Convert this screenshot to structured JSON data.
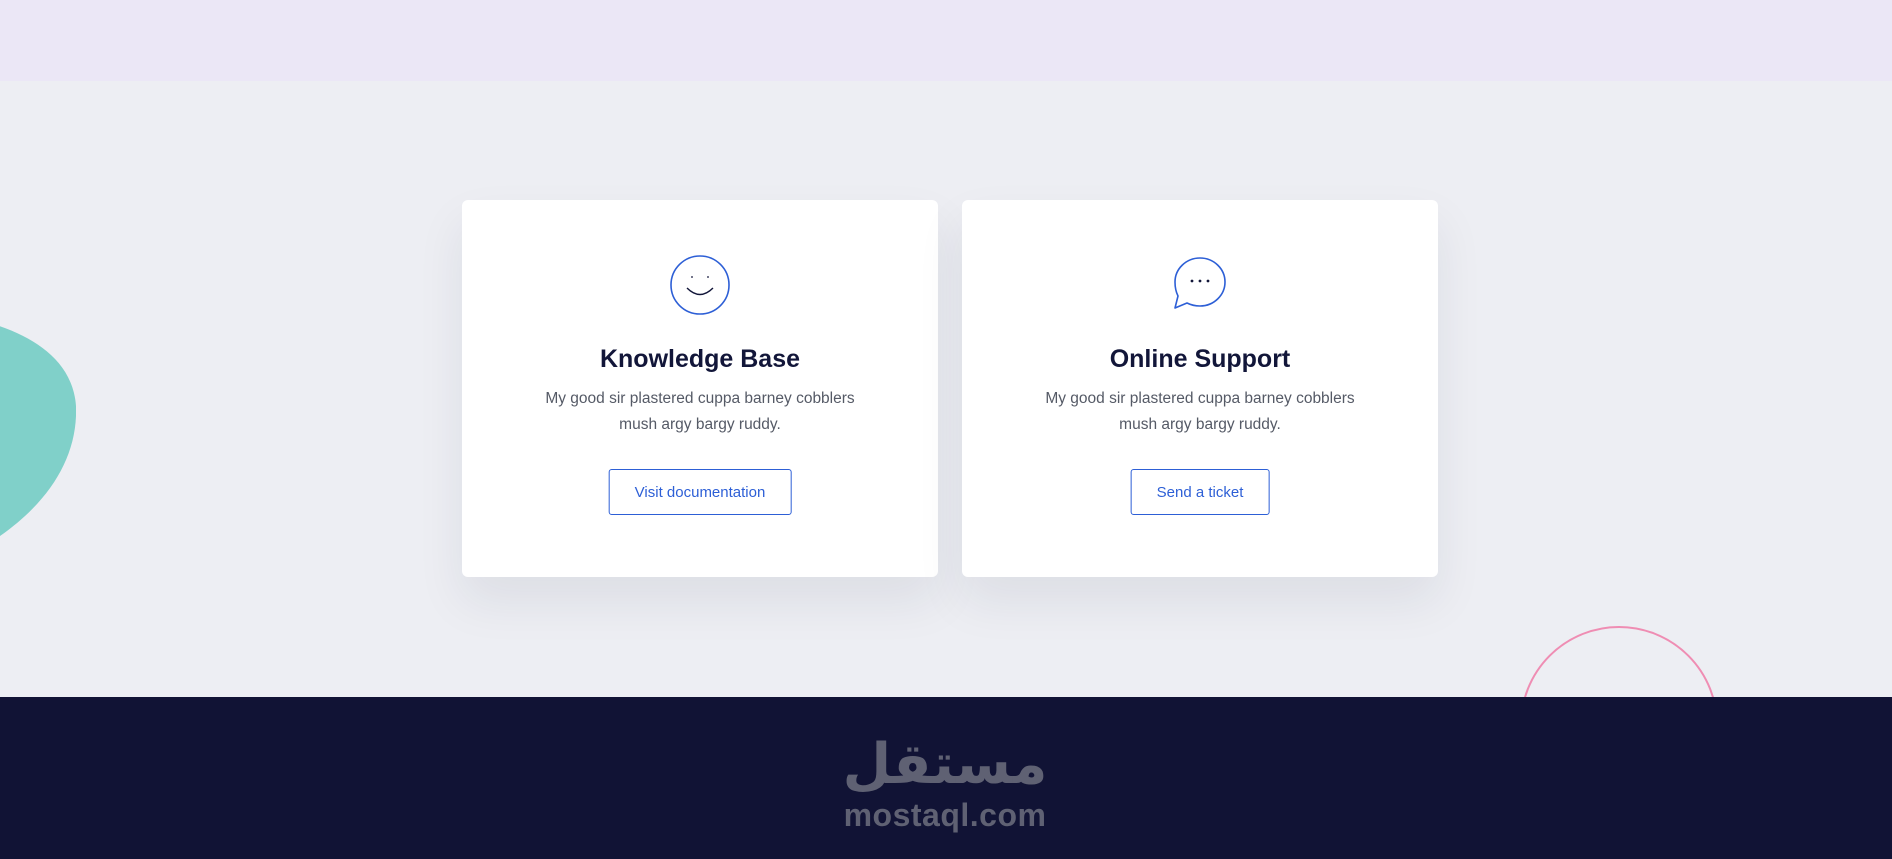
{
  "colors": {
    "accent": "#2d5fd6",
    "heading": "#121639",
    "body_text": "#555a66",
    "top_band": "#ebe7f6",
    "page_bg": "#edeef3",
    "footer_bg": "#111335",
    "teal_blob": "#80d0c9",
    "pink_ring": "#ef8db3"
  },
  "cards": [
    {
      "icon": "smiley-icon",
      "title": "Knowledge Base",
      "text": "My good sir plastered cuppa barney cobblers mush argy bargy ruddy.",
      "button_label": "Visit documentation"
    },
    {
      "icon": "chat-bubble-icon",
      "title": "Online Support",
      "text": "My good sir plastered cuppa barney cobblers mush argy bargy ruddy.",
      "button_label": "Send a ticket"
    }
  ],
  "watermark": {
    "arabic": "مستقل",
    "latin": "mostaql.com"
  }
}
